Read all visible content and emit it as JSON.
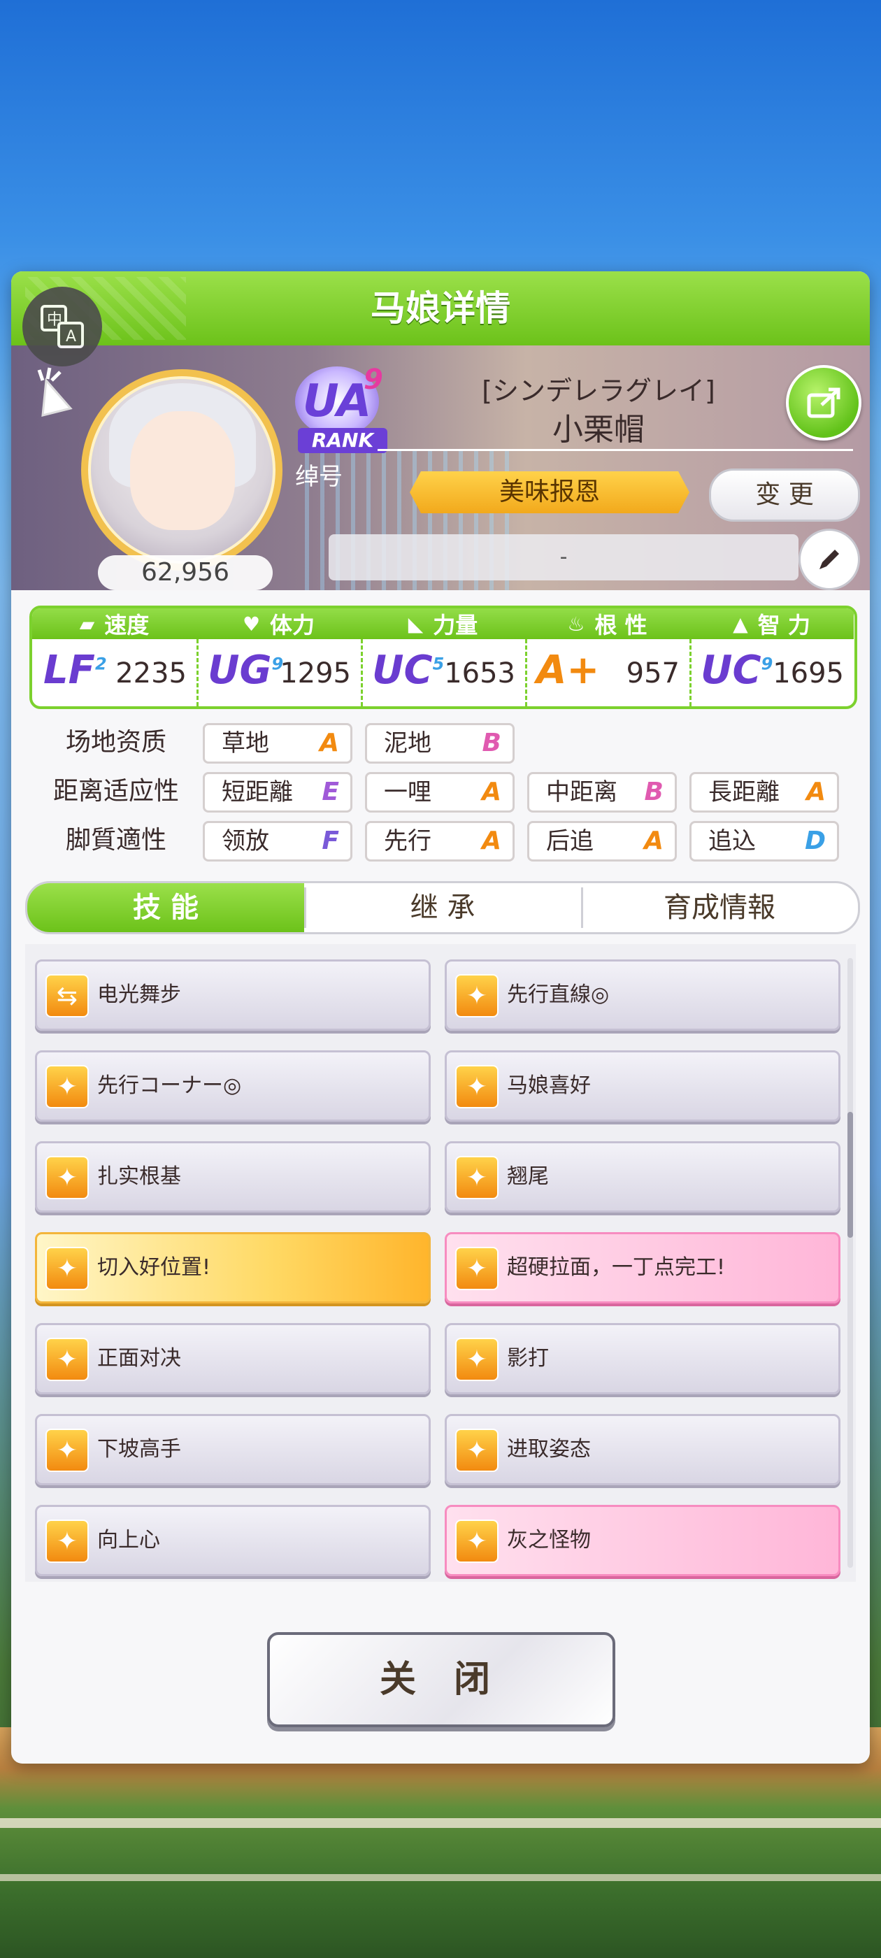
{
  "header": {
    "title": "马娘详情"
  },
  "translate_icon": "translate-icon",
  "profile": {
    "score": "62,956",
    "rank": {
      "badge": "UA",
      "level": "9",
      "rank_label": "RANK"
    },
    "title_label": "绰号",
    "epithet": "[シンデレラグレイ]",
    "name": "小栗帽",
    "title_ribbon": "美味报恩",
    "change_label": "变 更",
    "comment": "-"
  },
  "stats": [
    {
      "label": "速度",
      "grade": "LF",
      "sub": "2",
      "value": "2235",
      "icon": "shoe-icon"
    },
    {
      "label": "体力",
      "grade": "UG",
      "sub": "9",
      "value": "1295",
      "icon": "heart-icon"
    },
    {
      "label": "力量",
      "grade": "UC",
      "sub": "5",
      "value": "1653",
      "icon": "muscle-icon"
    },
    {
      "label": "根 性",
      "grade": "A+",
      "sub": "",
      "value": "957",
      "icon": "flame-icon"
    },
    {
      "label": "智 力",
      "grade": "UC",
      "sub": "9",
      "value": "1695",
      "icon": "grad-cap-icon"
    }
  ],
  "aptitude": {
    "track": {
      "label": "场地资质",
      "items": [
        {
          "name": "草地",
          "grade": "A"
        },
        {
          "name": "泥地",
          "grade": "B"
        }
      ]
    },
    "distance": {
      "label": "距离适应性",
      "items": [
        {
          "name": "短距離",
          "grade": "E"
        },
        {
          "name": "一哩",
          "grade": "A"
        },
        {
          "name": "中距离",
          "grade": "B"
        },
        {
          "name": "長距離",
          "grade": "A"
        }
      ]
    },
    "style": {
      "label": "脚質適性",
      "items": [
        {
          "name": "领放",
          "grade": "F"
        },
        {
          "name": "先行",
          "grade": "A"
        },
        {
          "name": "后追",
          "grade": "A"
        },
        {
          "name": "追込",
          "grade": "D"
        }
      ]
    }
  },
  "tabs": {
    "skills": "技 能",
    "inherit": "继 承",
    "training": "育成情報"
  },
  "skills": [
    {
      "name": "电光舞步",
      "style": "normal"
    },
    {
      "name": "先行直線◎",
      "style": "normal"
    },
    {
      "name": "先行コーナー◎",
      "style": "normal"
    },
    {
      "name": "马娘喜好",
      "style": "normal"
    },
    {
      "name": "扎实根基",
      "style": "normal"
    },
    {
      "name": "翘尾",
      "style": "normal"
    },
    {
      "name": "切入好位置!",
      "style": "gold"
    },
    {
      "name": "超硬拉面，一丁点完工!",
      "style": "pink"
    },
    {
      "name": "正面对决",
      "style": "normal"
    },
    {
      "name": "影打",
      "style": "normal"
    },
    {
      "name": "下坡高手",
      "style": "normal"
    },
    {
      "name": "进取姿态",
      "style": "normal"
    },
    {
      "name": "向上心",
      "style": "normal"
    },
    {
      "name": "灰之怪物",
      "style": "pink"
    }
  ],
  "close_label": "关 闭",
  "colors": {
    "accent_green": "#6cc21a",
    "gold": "#f2a91c",
    "pink": "#ffb6d8"
  }
}
